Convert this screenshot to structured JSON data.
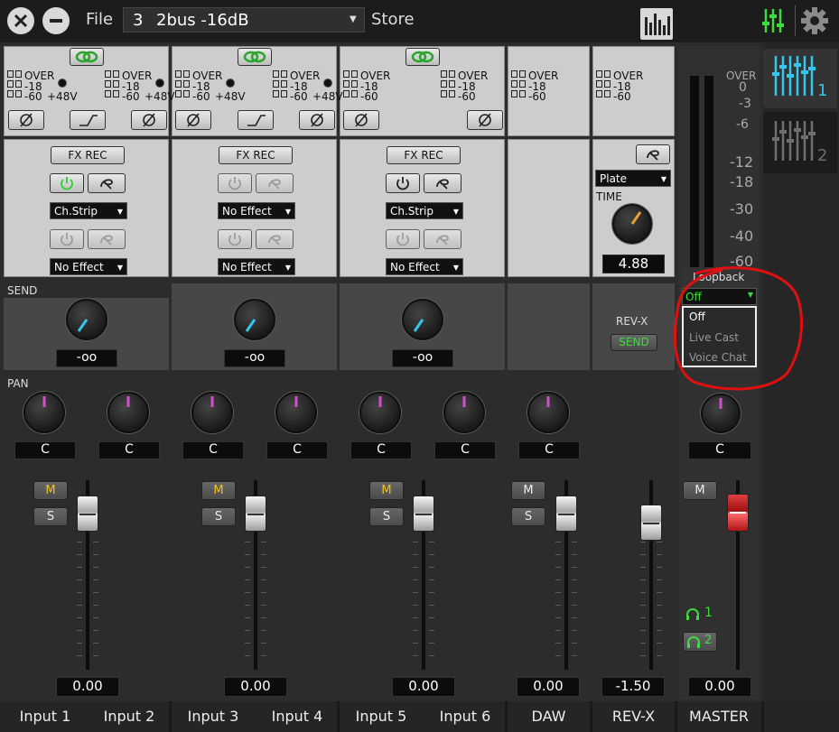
{
  "topbar": {
    "file_label": "File",
    "preset_number": "3",
    "preset_name": "2bus -16dB",
    "store_label": "Store"
  },
  "meter_labels": {
    "over": "OVER",
    "m18": "-18",
    "m60": "-60",
    "phantom": "+48V"
  },
  "fx": {
    "fx_rec": "FX REC",
    "effect_a": [
      "Ch.Strip",
      "No Effect",
      "Ch.Strip"
    ],
    "effect_b": [
      "No Effect",
      "No Effect",
      "No Effect"
    ]
  },
  "rev": {
    "type": "Plate",
    "time_label": "TIME",
    "time_value": "4.88",
    "rev_label": "REV-X",
    "send_label": "SEND"
  },
  "send": {
    "label": "SEND",
    "values": [
      "-oo",
      "-oo",
      "-oo"
    ]
  },
  "pan": {
    "label": "PAN",
    "values": [
      "C",
      "C",
      "C",
      "C",
      "C",
      "C",
      "C",
      "C"
    ]
  },
  "buttons": {
    "mute": "M",
    "solo": "S"
  },
  "faders": {
    "values": [
      "0.00",
      "0.00",
      "0.00",
      "0.00",
      "-1.50",
      "0.00"
    ]
  },
  "channels": [
    "Input 1",
    "Input 2",
    "Input 3",
    "Input 4",
    "Input 5",
    "Input 6",
    "DAW",
    "REV-X",
    "MASTER"
  ],
  "master_meter": {
    "labels": [
      "OVER",
      "0",
      "-3",
      "-6",
      "-12",
      "-18",
      "-30",
      "-40",
      "-60"
    ]
  },
  "loopback": {
    "title": "Loopback",
    "selected": "Off",
    "options": [
      "Off",
      "Live Cast",
      "Voice Chat"
    ]
  },
  "headphones": {
    "hp1": "1",
    "hp2": "2"
  },
  "colors": {
    "accent_green": "#3ddc3d",
    "accent_cyan": "#34c6ec",
    "knob_magenta": "#d04fcc",
    "mute_yellow": "#f0c419",
    "annotation_red": "#e01010"
  }
}
